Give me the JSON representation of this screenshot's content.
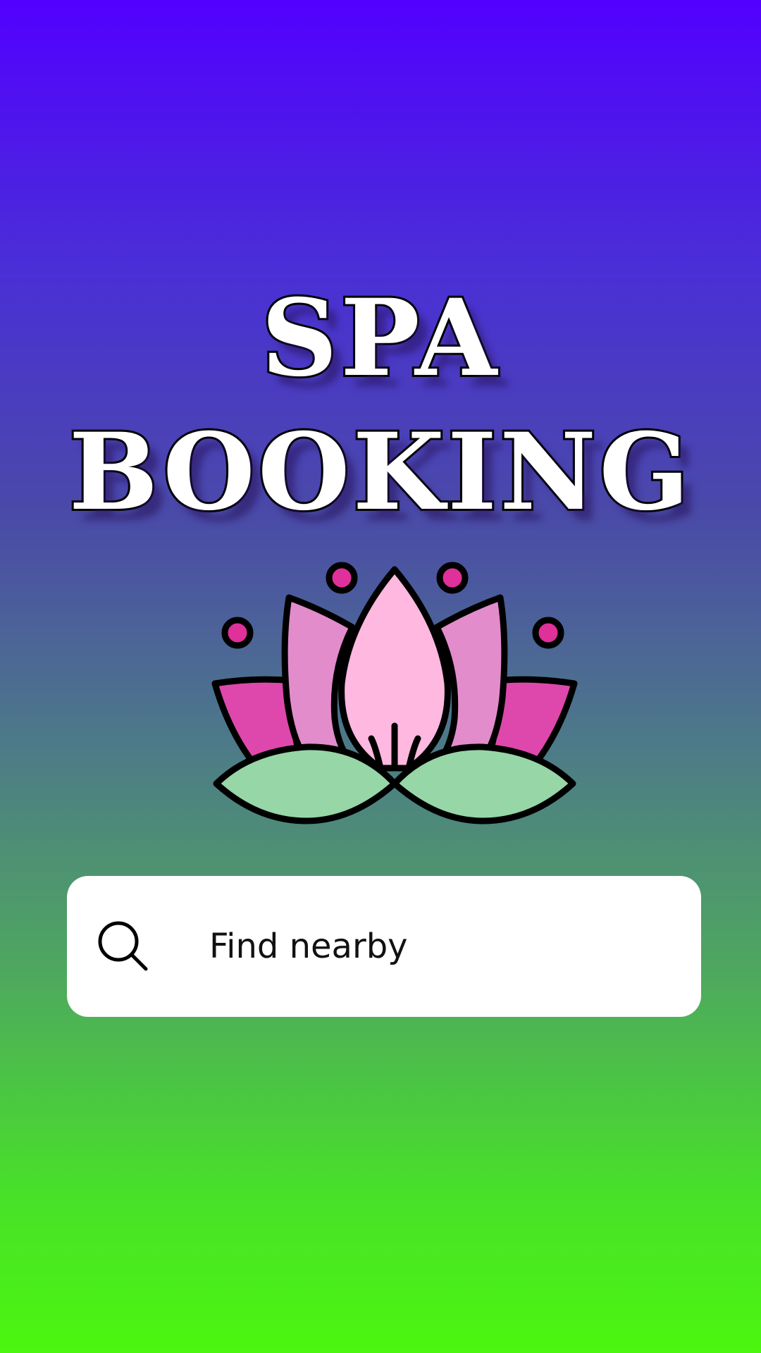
{
  "app": {
    "title_line_1": "SPA",
    "title_line_2": "BOOKING"
  },
  "hero": {
    "icon": "lotus-icon"
  },
  "search": {
    "placeholder": "Find nearby",
    "icon": "search-icon"
  },
  "colors": {
    "gradient_top": "#5200ff",
    "gradient_bottom": "#4cf60f",
    "title_fill": "#ffffff",
    "title_outline": "#000000",
    "search_background": "#ffffff"
  }
}
